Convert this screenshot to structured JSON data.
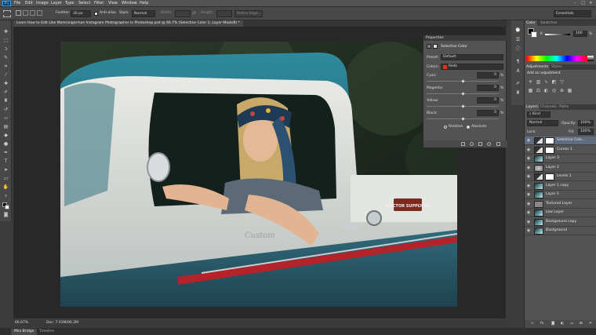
{
  "app": {
    "logo": "Ps"
  },
  "menu": [
    "File",
    "Edit",
    "Image",
    "Layer",
    "Type",
    "Select",
    "Filter",
    "View",
    "Window",
    "Help"
  ],
  "window_controls": [
    "–",
    "□",
    "✕"
  ],
  "options_bar": {
    "feather_label": "Feather:",
    "feather_value": "30 px",
    "anti_alias_label": "Anti-alias",
    "style_label": "Style:",
    "style_value": "Normal",
    "width_label": "Width:",
    "height_label": "Height:",
    "refine_edge": "Refine Edge...",
    "workspace": "Essentials"
  },
  "document": {
    "tab_title": "Learn How to Edit Like Markningerman Instagram Photographer in Photoshop.psd @ 66.7% (Selective Color 1, Layer Mask/8) *",
    "zoom": "66.67%",
    "doc_info": "Doc: 7.03M/96.2M"
  },
  "bottom_tabs": [
    "Mini Bridge",
    "Timeline"
  ],
  "properties": {
    "panel_title": "Properties",
    "adjustment_name": "Selective Color",
    "preset_label": "Preset:",
    "preset_value": "Default",
    "colors_label": "Colors:",
    "colors_value": "Reds",
    "colors_swatch": "#e0301e",
    "sliders": [
      {
        "label": "Cyan:",
        "value": "0",
        "unit": "%"
      },
      {
        "label": "Magenta:",
        "value": "0",
        "unit": "%"
      },
      {
        "label": "Yellow:",
        "value": "0",
        "unit": "%"
      },
      {
        "label": "Black:",
        "value": "0",
        "unit": "%"
      }
    ],
    "method_relative": "Relative",
    "method_absolute": "Absolute",
    "method_selected": "Absolute"
  },
  "color_panel": {
    "tabs": [
      "Color",
      "Swatches"
    ],
    "channel_label": "K",
    "channel_value": "100",
    "unit": "%"
  },
  "adjustments_panel": {
    "tabs": [
      "Adjustments",
      "Styles"
    ],
    "heading": "Add an adjustment"
  },
  "layers_panel": {
    "tabs": [
      "Layers",
      "Channels",
      "Paths"
    ],
    "kind_label": "Kind",
    "blend_mode": "Normal",
    "opacity_label": "Opacity:",
    "opacity_value": "100%",
    "lock_label": "Lock:",
    "fill_label": "Fill:",
    "fill_value": "100%",
    "layers": [
      {
        "name": "Selective Colo...",
        "selected": true,
        "thumb": "adjustment",
        "mask": true
      },
      {
        "name": "Curves 1",
        "selected": false,
        "thumb": "adjustment",
        "mask": true
      },
      {
        "name": "Layer 3",
        "selected": false,
        "thumb": "photo",
        "mask": false
      },
      {
        "name": "Layer 2",
        "selected": false,
        "thumb": "blur",
        "mask": false
      },
      {
        "name": "Levels 1",
        "selected": false,
        "thumb": "adjustment",
        "mask": true
      },
      {
        "name": "Layer 1 copy",
        "selected": false,
        "thumb": "photo",
        "mask": false
      },
      {
        "name": "Layer 1",
        "selected": false,
        "thumb": "photo",
        "mask": false
      },
      {
        "name": "Textured Layer",
        "selected": false,
        "thumb": "gray",
        "mask": false
      },
      {
        "name": "Low Layer",
        "selected": false,
        "thumb": "photo",
        "mask": false
      },
      {
        "name": "Background copy",
        "selected": false,
        "thumb": "photo",
        "mask": false
      },
      {
        "name": "Background",
        "selected": false,
        "thumb": "photo",
        "mask": false
      }
    ]
  },
  "photo": {
    "license_plate": "TRACTOR SUPPLY CO.",
    "truck_script": "Custom"
  }
}
